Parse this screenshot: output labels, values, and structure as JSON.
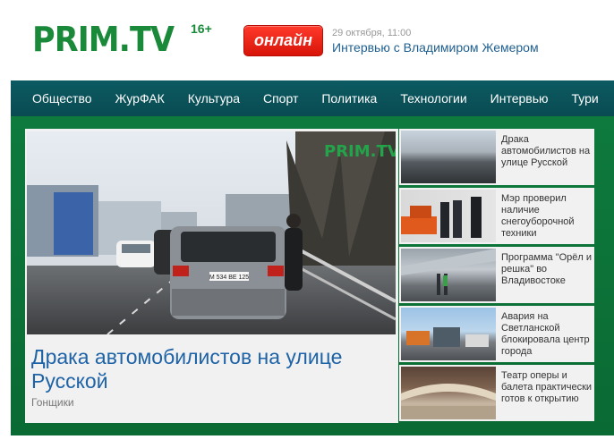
{
  "header": {
    "logo_text": "PRIM.TV",
    "age_rating": "16+",
    "online_label": "онлайн",
    "live_date": "29 октября, 11:00",
    "live_title": "Интервью с Владимиром Жемером"
  },
  "nav": {
    "items": [
      "Общество",
      "ЖурФАК",
      "Культура",
      "Спорт",
      "Политика",
      "Технологии",
      "Интервью",
      "Тури"
    ]
  },
  "featured": {
    "title": "Драка автомобилистов на улице Русской",
    "category": "Гонщики",
    "photo_watermark": "PRIM.TV",
    "plate": "М 534 ВЕ 125"
  },
  "sidebar": {
    "items": [
      {
        "title": "Драка автомобилистов на улице Русской",
        "thumb": "traffic-street"
      },
      {
        "title": "Мэр проверил наличие снегоуборочной техники",
        "thumb": "snow-equipment"
      },
      {
        "title": "Программа \"Орёл и решка\" во Владивостоке",
        "thumb": "airport-hall"
      },
      {
        "title": "Авария на Светланской блокировала центр города",
        "thumb": "street-accident"
      },
      {
        "title": "Театр оперы и балета практически готов к открытию",
        "thumb": "theater-hall"
      }
    ]
  },
  "colors": {
    "brand_green": "#1a8a3a",
    "nav_bg": "#0c5a62",
    "content_bg": "#0e7a3d",
    "online_red": "#e0190d",
    "link_blue": "#1e63a6"
  }
}
